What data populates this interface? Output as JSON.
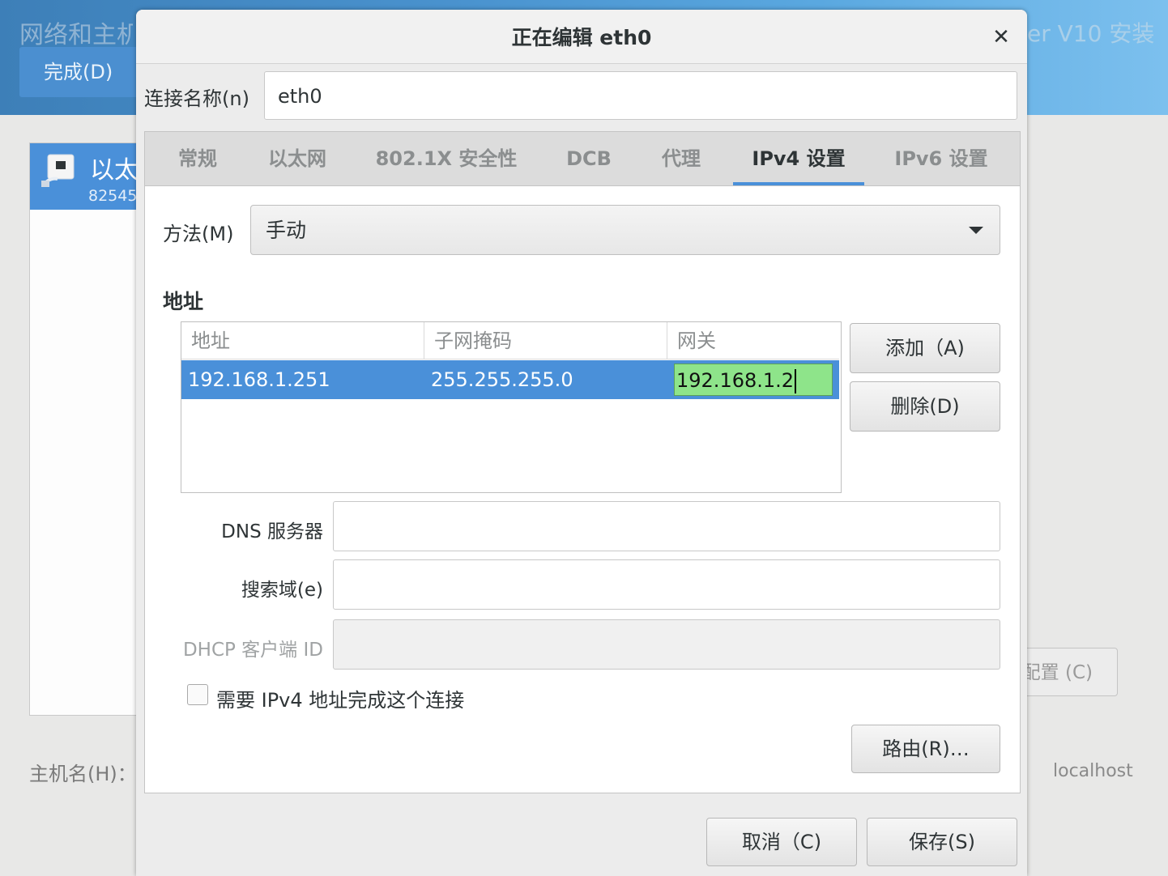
{
  "background": {
    "title_left": "网络和主机",
    "title_right": "er V10 安装",
    "done_button": "完成(D)",
    "device_name": "以太",
    "device_sub": "82545",
    "hostname_label": "主机名(H)：",
    "configure_button": "配置 (C)",
    "hostname_value": "localhost"
  },
  "dialog": {
    "title": "正在编辑 eth0",
    "close_symbol": "✕",
    "connection_name_label": "连接名称(n)",
    "connection_name_value": "eth0",
    "tabs": [
      "常规",
      "以太网",
      "802.1X 安全性",
      "DCB",
      "代理",
      "IPv4 设置",
      "IPv6 设置"
    ],
    "active_tab": "IPv4 设置",
    "method_label": "方法(M)",
    "method_value": "手动",
    "address_heading": "地址",
    "address_table": {
      "columns": [
        "地址",
        "子网掩码",
        "网关"
      ],
      "rows": [
        {
          "address": "192.168.1.251",
          "netmask": "255.255.255.0",
          "gateway": "192.168.1.2"
        }
      ]
    },
    "add_button": "添加（A)",
    "delete_button": "删除(D)",
    "dns_label": "DNS 服务器",
    "dns_value": "",
    "search_label": "搜索域(e)",
    "search_value": "",
    "dhcp_label": "DHCP 客户端 ID",
    "dhcp_value": "",
    "require_ipv4_label": "需要 IPv4 地址完成这个连接",
    "require_ipv4_checked": false,
    "routes_button": "路由(R)…",
    "cancel_button": "取消（C)",
    "save_button": "保存(S)"
  }
}
